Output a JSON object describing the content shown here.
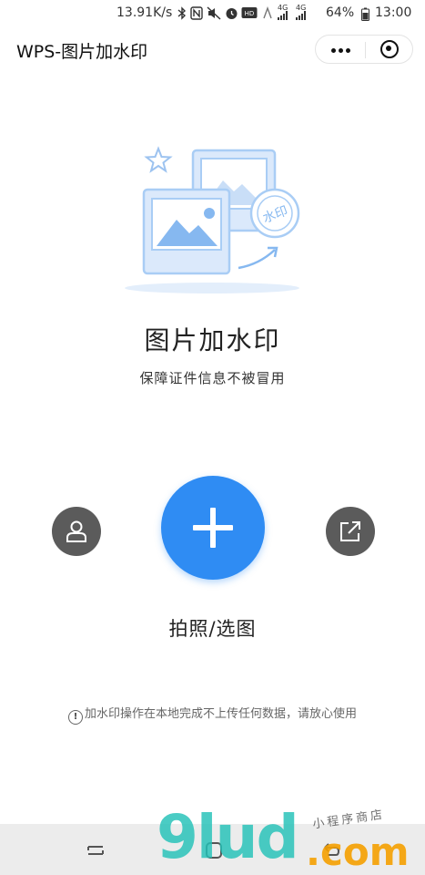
{
  "status_bar": {
    "speed": "13.91K/s",
    "network": "4G",
    "battery": "64%",
    "time": "13:00",
    "icons": [
      "bluetooth-icon",
      "nfc-icon",
      "mute-icon",
      "alarm-icon",
      "hd-icon",
      "signal-icon",
      "battery-icon"
    ]
  },
  "title_bar": {
    "title": "WPS-图片加水印",
    "more_icon": "more-dots-icon",
    "close_icon": "circle-target-icon"
  },
  "hero": {
    "illustration_stamp_text": "水印",
    "title": "图片加水印",
    "subtitle": "保障证件信息不被冒用"
  },
  "actions": {
    "profile_icon": "person-icon",
    "add_icon": "plus-icon",
    "share_icon": "external-link-icon",
    "add_label": "拍照/选图"
  },
  "notice": {
    "icon": "info-icon",
    "icon_glyph": "!",
    "text": "加水印操作在本地完成不上传任何数据，请放心使用"
  },
  "watermark": {
    "logo": "9lud",
    "domain": ".com",
    "tag": "小程序商店"
  },
  "colors": {
    "accent": "#2f8cf3",
    "side_button": "#5b5b5b",
    "illustration_blue": "#a9cdf5",
    "nav_bg": "#ececec"
  }
}
